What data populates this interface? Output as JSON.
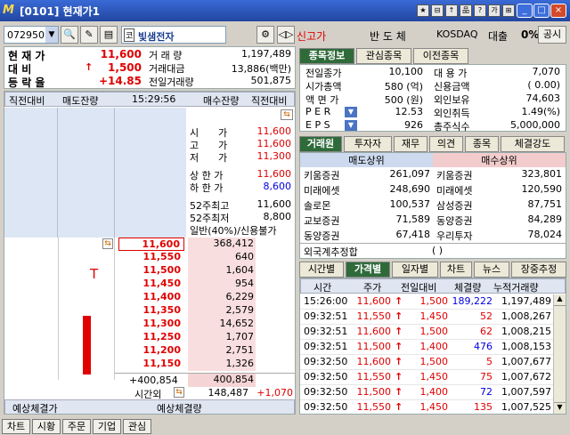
{
  "title": "[0101] 현재가1",
  "titlebar_icons": [
    "★",
    "⊟",
    "↑",
    "品",
    "?",
    "가",
    "⊞"
  ],
  "window_buttons": [
    "_",
    "□",
    "×"
  ],
  "toolbar": {
    "code": "072950",
    "stock_name": "빛샘전자",
    "status": "신고가",
    "board": "반 도 체",
    "market": "KOSDAQ",
    "loan": "대출",
    "margin_pct": "0%",
    "disclosure": "공시",
    "stock_prefix": "코"
  },
  "summary": {
    "labels": [
      "현 재 가",
      "대 비",
      "등 락 율"
    ],
    "values": [
      "11,600",
      "1,500",
      "+14.85"
    ],
    "arrow": "↑",
    "vol_labels": [
      "거 래 량",
      "거래대금",
      "전일거래량"
    ],
    "vol_values": [
      "1,197,489",
      "13,886(백만)",
      "501,875"
    ]
  },
  "orderbook": {
    "headers": [
      "직전대비",
      "매도잔량",
      "15:29:56",
      "매수잔량",
      "직전대비"
    ],
    "price_info_labels": [
      "시",
      "고",
      "저"
    ],
    "price_info_suffix": [
      "가",
      "가",
      "가"
    ],
    "price_info_values": [
      "11,600",
      "11,600",
      "11,300"
    ],
    "limit_labels": [
      "상 한 가",
      "하 한 가"
    ],
    "limit_values": [
      "11,600",
      "8,600"
    ],
    "week52_labels": [
      "52주최고",
      "52주최저",
      "일반(40%)/신용불가"
    ],
    "week52_values": [
      "11,600",
      "8,800"
    ],
    "rows": [
      {
        "price": "11,600",
        "qty": "368,412",
        "mark": "⇆"
      },
      {
        "price": "11,550",
        "qty": "640"
      },
      {
        "price": "11,500",
        "qty": "1,604"
      },
      {
        "price": "11,450",
        "qty": "954"
      },
      {
        "price": "11,400",
        "qty": "6,229"
      },
      {
        "price": "11,350",
        "qty": "2,579"
      },
      {
        "price": "11,300",
        "qty": "14,652"
      },
      {
        "price": "11,250",
        "qty": "1,707"
      },
      {
        "price": "11,200",
        "qty": "2,751"
      },
      {
        "price": "11,150",
        "qty": "1,326"
      }
    ],
    "bar_marker": "T",
    "totals": {
      "left": "+400,854",
      "right": "400,854"
    },
    "afterhours": {
      "label": "시간외",
      "value": "148,487",
      "change": "+1,070",
      "mark": "⇆"
    },
    "footer": [
      "예상체결가",
      "예상체결량"
    ]
  },
  "info_tabs": [
    "종목정보",
    "관심종목",
    "이전종목"
  ],
  "info": {
    "left_labels": [
      "전일종가",
      "시가총액",
      "액 면 가",
      "P E R",
      "E P S"
    ],
    "left_values": [
      "10,100",
      "580 (억)",
      "500 (원)",
      "12.53",
      "926"
    ],
    "right_labels": [
      "대 용 가",
      "신용금액",
      "외인보유",
      "외인취득",
      "총주식수"
    ],
    "right_values": [
      "7,070",
      "( 0.00)",
      "74,603",
      "1.49(%)",
      "5,000,000"
    ]
  },
  "broker_tabs": [
    "거래원",
    "투자자",
    "재무",
    "의견",
    "종목",
    "체결강도"
  ],
  "broker": {
    "sell_header": "매도상위",
    "buy_header": "매수상위",
    "sell": [
      [
        "키움증권",
        "261,097"
      ],
      [
        "미래에셋",
        "248,690"
      ],
      [
        "솔로몬",
        "100,537"
      ],
      [
        "교보증권",
        "71,589"
      ],
      [
        "동양증권",
        "67,418"
      ]
    ],
    "buy": [
      [
        "키움증권",
        "323,801"
      ],
      [
        "미래에셋",
        "120,590"
      ],
      [
        "삼성증권",
        "87,751"
      ],
      [
        "동양증권",
        "84,289"
      ],
      [
        "우리투자",
        "78,024"
      ]
    ],
    "foreign_label": "외국계추정합",
    "foreign_paren": "(                 )"
  },
  "trade_tabs": [
    "시간별",
    "가격별",
    "일자별",
    "차트",
    "뉴스",
    "장중추정"
  ],
  "trades": {
    "headers": [
      "시간",
      "주가",
      "전일대비",
      "체결량",
      "누적거래량"
    ],
    "rows": [
      [
        "15:26:00",
        "11,600",
        "1,500",
        "189,222",
        "1,197,489",
        "blue"
      ],
      [
        "09:32:51",
        "11,550",
        "1,450",
        "52",
        "1,008,267",
        "red"
      ],
      [
        "09:32:51",
        "11,600",
        "1,500",
        "62",
        "1,008,215",
        "red"
      ],
      [
        "09:32:51",
        "11,500",
        "1,400",
        "476",
        "1,008,153",
        "blue"
      ],
      [
        "09:32:50",
        "11,600",
        "1,500",
        "5",
        "1,007,677",
        "red"
      ],
      [
        "09:32:50",
        "11,550",
        "1,450",
        "75",
        "1,007,672",
        "red"
      ],
      [
        "09:32:50",
        "11,500",
        "1,400",
        "72",
        "1,007,597",
        "blue"
      ],
      [
        "09:32:50",
        "11,550",
        "1,450",
        "135",
        "1,007,525",
        "red"
      ]
    ]
  },
  "bottom_tabs": [
    "차트",
    "시황",
    "주문",
    "기업",
    "관심"
  ],
  "colors": {
    "red": "#e00000",
    "blue": "#0000e0",
    "green": "#2f6b3a",
    "title": "#2246a0",
    "sellbg": "#dde6f4",
    "buybg": "#f8e0e0"
  }
}
